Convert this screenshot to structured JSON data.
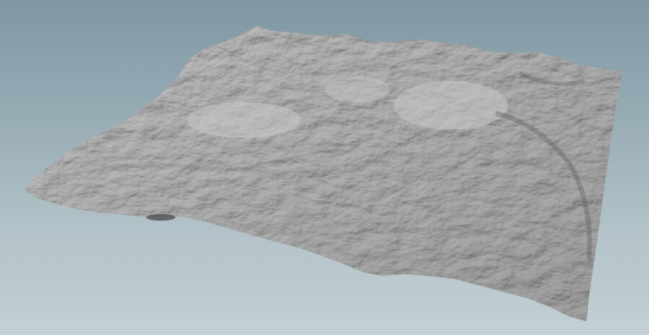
{
  "scene": {
    "background_top_color": "#7f97a3",
    "background_bottom_color": "#c3d0d4",
    "terrain_color": "#b2b2b2",
    "terrain_highlight_color": "#d0d0d0",
    "terrain_shadow_color": "#6e6e6e",
    "subject": "terrain-heightfield"
  }
}
